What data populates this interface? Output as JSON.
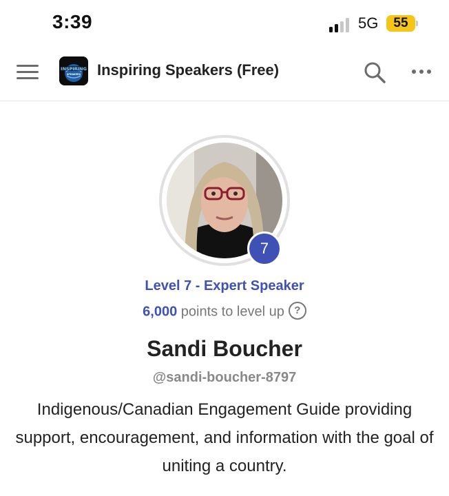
{
  "status_bar": {
    "time": "3:39",
    "network": "5G",
    "battery": "55",
    "battery_color": "#f5c518"
  },
  "app_bar": {
    "title": "Inspiring Speakers (Free)",
    "logo_text": "INSPIRING",
    "logo_subtext": "SPEAKERS",
    "icons": [
      "menu-icon",
      "search-icon",
      "more-icon"
    ]
  },
  "profile": {
    "level_number": "7",
    "level_label": "Level 7 - Expert Speaker",
    "points_value": "6,000",
    "points_suffix": " points to level up",
    "help_glyph": "?",
    "name": "Sandi Boucher",
    "handle": "@sandi-boucher-8797",
    "bio": "Indigenous/Canadian Engagement Guide providing support, encouragement, and information with the goal of uniting a country.",
    "accent_color": "#3f51b5"
  }
}
